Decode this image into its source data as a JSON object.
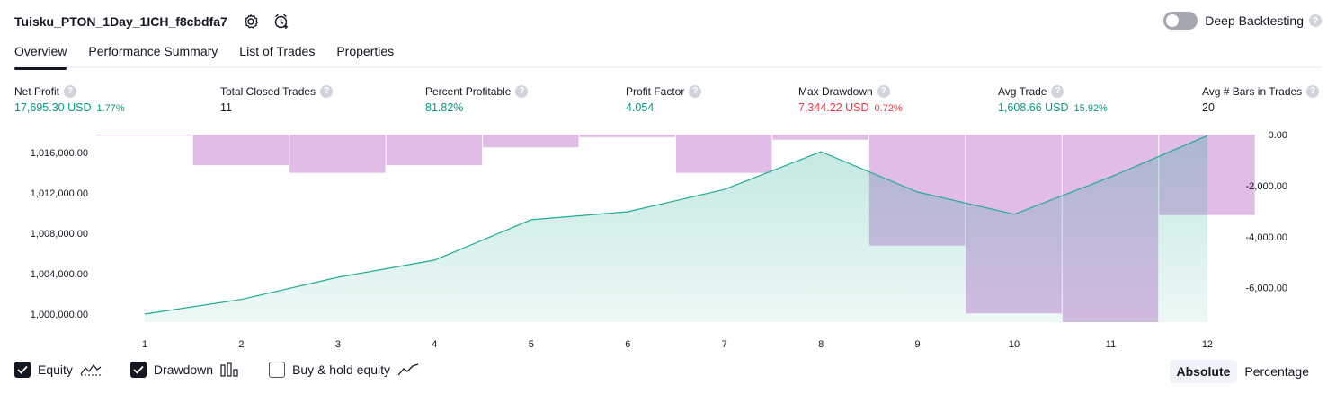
{
  "header": {
    "title": "Tuisku_PTON_1Day_1ICH_f8cbdfa7",
    "settings_icon": "settings-gear-icon",
    "alert_icon": "add-alert-clock-icon"
  },
  "deep_backtesting": {
    "label": "Deep Backtesting",
    "enabled": false,
    "help": "?"
  },
  "tabs": [
    {
      "label": "Overview",
      "active": true
    },
    {
      "label": "Performance Summary",
      "active": false
    },
    {
      "label": "List of Trades",
      "active": false
    },
    {
      "label": "Properties",
      "active": false
    }
  ],
  "metrics": [
    {
      "label": "Net Profit",
      "value": "17,695.30 USD",
      "pct": "1.77%",
      "tone": "pos"
    },
    {
      "label": "Total Closed Trades",
      "value": "11",
      "pct": "",
      "tone": "neutral"
    },
    {
      "label": "Percent Profitable",
      "value": "81.82%",
      "pct": "",
      "tone": "pos"
    },
    {
      "label": "Profit Factor",
      "value": "4.054",
      "pct": "",
      "tone": "pos"
    },
    {
      "label": "Max Drawdown",
      "value": "7,344.22 USD",
      "pct": "0.72%",
      "tone": "neg"
    },
    {
      "label": "Avg Trade",
      "value": "1,608.66 USD",
      "pct": "15.92%",
      "tone": "pos"
    },
    {
      "label": "Avg # Bars in Trades",
      "value": "20",
      "pct": "",
      "tone": "neutral"
    }
  ],
  "colors": {
    "positive": "#089981",
    "negative": "#f23645",
    "equity_line": "#22ab94",
    "drawdown_fill": "#ce93d8"
  },
  "chart_data": {
    "type": "area",
    "x": [
      1,
      2,
      3,
      4,
      5,
      6,
      7,
      8,
      9,
      10,
      11,
      12
    ],
    "x_tick_labels": [
      "1",
      "2",
      "3",
      "4",
      "5",
      "6",
      "7",
      "8",
      "9",
      "10",
      "11",
      "12"
    ],
    "series": [
      {
        "name": "Equity",
        "axis": "left",
        "values": [
          1000000,
          1001450,
          1003650,
          1005350,
          1009350,
          1010150,
          1012350,
          1016100,
          1012100,
          1009900,
          1013600,
          1017695.3
        ]
      },
      {
        "name": "Drawdown",
        "axis": "right",
        "kind": "bar",
        "values": [
          0,
          -1200,
          -1500,
          -1200,
          -500,
          -100,
          -1500,
          -200,
          -4350,
          -7000,
          -7344.22,
          -3150
        ]
      }
    ],
    "left_axis": {
      "ylim": [
        999200,
        1017800
      ],
      "ticks": [
        1000000,
        1004000,
        1008000,
        1012000,
        1016000
      ],
      "tick_labels": [
        "1,000,000.00",
        "1,004,000.00",
        "1,008,000.00",
        "1,012,000.00",
        "1,016,000.00"
      ]
    },
    "right_axis": {
      "ylim": [
        -7344.22,
        0
      ],
      "ticks": [
        0,
        -2000,
        -4000,
        -6000
      ],
      "tick_labels": [
        "0.00",
        "-2,000.00",
        "-4,000.00",
        "-6,000.00"
      ]
    },
    "grid": false
  },
  "legend": [
    {
      "label": "Equity",
      "checked": true,
      "icon": "equity-line-icon"
    },
    {
      "label": "Drawdown",
      "checked": true,
      "icon": "drawdown-bars-icon"
    },
    {
      "label": "Buy & hold equity",
      "checked": false,
      "icon": "buy-hold-line-icon"
    }
  ],
  "scale": {
    "options": [
      "Absolute",
      "Percentage"
    ],
    "selected": "Absolute"
  }
}
